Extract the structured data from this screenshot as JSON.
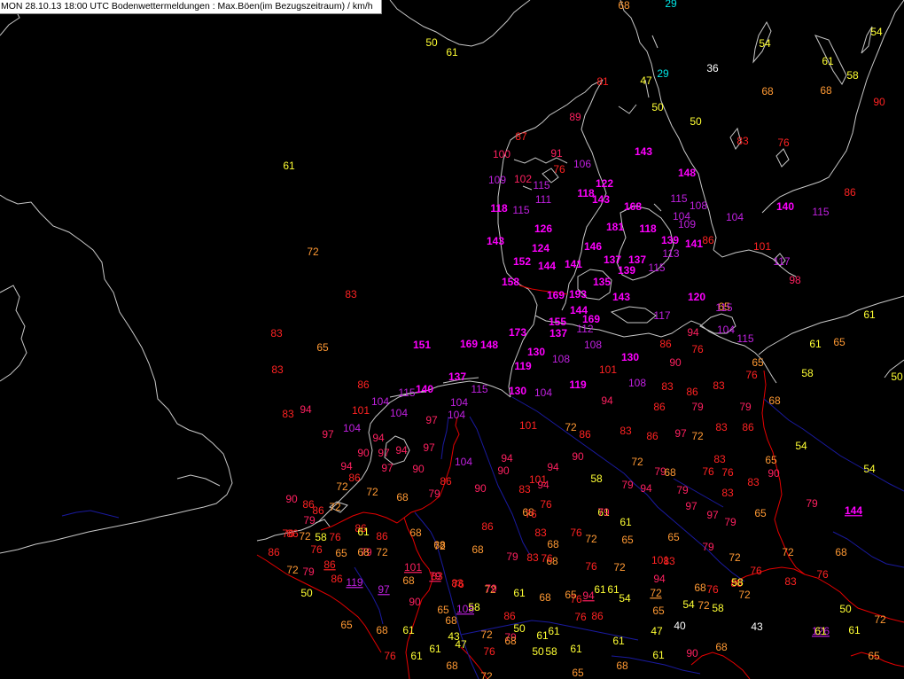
{
  "title": "MON 28.10.13 18:00 UTC  Bodenwettermeldungen :  Max.Böen(im Bezugszeitraum) / km/h",
  "colors": {
    "background": "#000000",
    "coastline": "#c8c8c8",
    "border": "#e60000",
    "river": "#1a1aa0",
    "c_cyan": "#00e5e5",
    "c_white": "#ffffff",
    "c_yellow": "#ffff33",
    "c_orange": "#ff9933",
    "c_red": "#ff2222",
    "c_crimson": "#ff2060",
    "c_violet": "#c020e0",
    "c_magenta": "#ff00ff"
  },
  "observations": [
    {
      "v": "68",
      "c": "orange"
    },
    {
      "v": "29",
      "c": "cyan"
    },
    {
      "v": "50",
      "c": "yellow"
    },
    {
      "v": "61",
      "c": "yellow"
    },
    {
      "v": "54",
      "c": "yellow"
    },
    {
      "v": "54",
      "c": "yellow"
    },
    {
      "v": "61",
      "c": "yellow"
    },
    {
      "v": "58",
      "c": "yellow"
    },
    {
      "v": "36",
      "c": "white"
    },
    {
      "v": "47",
      "c": "yellow"
    },
    {
      "v": "29",
      "c": "cyan"
    },
    {
      "v": "68",
      "c": "orange"
    },
    {
      "v": "68",
      "c": "orange"
    },
    {
      "v": "90",
      "c": "red"
    },
    {
      "v": "81",
      "c": "red"
    },
    {
      "v": "50",
      "c": "yellow"
    },
    {
      "v": "50",
      "c": "yellow"
    },
    {
      "v": "89",
      "c": "crimson"
    },
    {
      "v": "87",
      "c": "red"
    },
    {
      "v": "83",
      "c": "red"
    },
    {
      "v": "76",
      "c": "red"
    },
    {
      "v": "61",
      "c": "yellow"
    },
    {
      "v": "100",
      "c": "crimson"
    },
    {
      "v": "91",
      "c": "crimson"
    },
    {
      "v": "76",
      "c": "red"
    },
    {
      "v": "106",
      "c": "violet"
    },
    {
      "v": "143",
      "c": "magenta"
    },
    {
      "v": "109",
      "c": "violet"
    },
    {
      "v": "102",
      "c": "crimson"
    },
    {
      "v": "115",
      "c": "violet"
    },
    {
      "v": "122",
      "c": "magenta"
    },
    {
      "v": "148",
      "c": "magenta"
    },
    {
      "v": "86",
      "c": "red"
    },
    {
      "v": "111",
      "c": "violet"
    },
    {
      "v": "118",
      "c": "magenta"
    },
    {
      "v": "143",
      "c": "magenta"
    },
    {
      "v": "115",
      "c": "violet"
    },
    {
      "v": "108",
      "c": "violet"
    },
    {
      "v": "118",
      "c": "magenta"
    },
    {
      "v": "115",
      "c": "violet"
    },
    {
      "v": "168",
      "c": "magenta"
    },
    {
      "v": "104",
      "c": "violet"
    },
    {
      "v": "104",
      "c": "violet"
    },
    {
      "v": "140",
      "c": "magenta"
    },
    {
      "v": "115",
      "c": "violet"
    },
    {
      "v": "126",
      "c": "magenta"
    },
    {
      "v": "181",
      "c": "magenta"
    },
    {
      "v": "118",
      "c": "magenta"
    },
    {
      "v": "109",
      "c": "violet"
    },
    {
      "v": "143",
      "c": "magenta"
    },
    {
      "v": "139",
      "c": "magenta"
    },
    {
      "v": "141",
      "c": "magenta"
    },
    {
      "v": "86",
      "c": "red"
    },
    {
      "v": "124",
      "c": "magenta"
    },
    {
      "v": "146",
      "c": "magenta"
    },
    {
      "v": "72",
      "c": "orange"
    },
    {
      "v": "101",
      "c": "red"
    },
    {
      "v": "113",
      "c": "violet"
    },
    {
      "v": "137",
      "c": "magenta"
    },
    {
      "v": "152",
      "c": "magenta"
    },
    {
      "v": "144",
      "c": "magenta"
    },
    {
      "v": "141",
      "c": "magenta"
    },
    {
      "v": "137",
      "c": "magenta"
    },
    {
      "v": "139",
      "c": "magenta"
    },
    {
      "v": "115",
      "c": "violet"
    },
    {
      "v": "117",
      "c": "violet"
    },
    {
      "v": "83",
      "c": "red"
    },
    {
      "v": "158",
      "c": "magenta"
    },
    {
      "v": "135",
      "c": "magenta"
    },
    {
      "v": "98",
      "c": "crimson"
    },
    {
      "v": "169",
      "c": "magenta"
    },
    {
      "v": "193",
      "c": "magenta"
    },
    {
      "v": "143",
      "c": "magenta"
    },
    {
      "v": "120",
      "c": "magenta"
    },
    {
      "v": "65",
      "c": "orange"
    },
    {
      "v": "115",
      "c": "violet"
    },
    {
      "v": "144",
      "c": "magenta"
    },
    {
      "v": "169",
      "c": "magenta"
    },
    {
      "v": "117",
      "c": "violet"
    },
    {
      "v": "61",
      "c": "yellow"
    },
    {
      "v": "83",
      "c": "red"
    },
    {
      "v": "155",
      "c": "magenta"
    },
    {
      "v": "137",
      "c": "magenta"
    },
    {
      "v": "112",
      "c": "violet"
    },
    {
      "v": "94",
      "c": "crimson"
    },
    {
      "v": "104",
      "c": "violet"
    },
    {
      "v": "173",
      "c": "magenta"
    },
    {
      "v": "115",
      "c": "violet"
    },
    {
      "v": "151",
      "c": "magenta"
    },
    {
      "v": "169",
      "c": "magenta"
    },
    {
      "v": "148",
      "c": "magenta"
    },
    {
      "v": "108",
      "c": "violet"
    },
    {
      "v": "86",
      "c": "red"
    },
    {
      "v": "76",
      "c": "red"
    },
    {
      "v": "61",
      "c": "yellow"
    },
    {
      "v": "65",
      "c": "orange"
    },
    {
      "v": "65",
      "c": "orange"
    },
    {
      "v": "130",
      "c": "magenta"
    },
    {
      "v": "108",
      "c": "violet"
    },
    {
      "v": "130",
      "c": "magenta"
    },
    {
      "v": "90",
      "c": "crimson"
    },
    {
      "v": "65",
      "c": "orange"
    },
    {
      "v": "83",
      "c": "red"
    },
    {
      "v": "119",
      "c": "magenta"
    },
    {
      "v": "101",
      "c": "red"
    },
    {
      "v": "76",
      "c": "red"
    },
    {
      "v": "58",
      "c": "yellow"
    },
    {
      "v": "50",
      "c": "yellow"
    },
    {
      "v": "137",
      "c": "magenta"
    },
    {
      "v": "115",
      "c": "violet"
    },
    {
      "v": "119",
      "c": "magenta"
    },
    {
      "v": "108",
      "c": "violet"
    },
    {
      "v": "86",
      "c": "red"
    },
    {
      "v": "115",
      "c": "violet"
    },
    {
      "v": "140",
      "c": "magenta"
    },
    {
      "v": "130",
      "c": "magenta"
    },
    {
      "v": "104",
      "c": "violet"
    },
    {
      "v": "83",
      "c": "red"
    },
    {
      "v": "86",
      "c": "red"
    },
    {
      "v": "83",
      "c": "red"
    },
    {
      "v": "104",
      "c": "violet"
    },
    {
      "v": "104",
      "c": "violet"
    },
    {
      "v": "94",
      "c": "crimson"
    },
    {
      "v": "86",
      "c": "red"
    },
    {
      "v": "79",
      "c": "crimson"
    },
    {
      "v": "79",
      "c": "crimson"
    },
    {
      "v": "68",
      "c": "orange"
    },
    {
      "v": "83",
      "c": "red"
    },
    {
      "v": "94",
      "c": "crimson"
    },
    {
      "v": "101",
      "c": "red"
    },
    {
      "v": "104",
      "c": "violet"
    },
    {
      "v": "104",
      "c": "violet"
    },
    {
      "v": "97",
      "c": "crimson"
    },
    {
      "v": "104",
      "c": "violet"
    },
    {
      "v": "101",
      "c": "red"
    },
    {
      "v": "72",
      "c": "orange"
    },
    {
      "v": "86",
      "c": "red"
    },
    {
      "v": "83",
      "c": "red"
    },
    {
      "v": "86",
      "c": "red"
    },
    {
      "v": "97",
      "c": "crimson"
    },
    {
      "v": "72",
      "c": "orange"
    },
    {
      "v": "83",
      "c": "red"
    },
    {
      "v": "86",
      "c": "red"
    },
    {
      "v": "97",
      "c": "crimson"
    },
    {
      "v": "94",
      "c": "crimson"
    },
    {
      "v": "54",
      "c": "yellow"
    },
    {
      "v": "54",
      "c": "yellow"
    },
    {
      "v": "90",
      "c": "crimson"
    },
    {
      "v": "97",
      "c": "crimson"
    },
    {
      "v": "94",
      "c": "crimson"
    },
    {
      "v": "97",
      "c": "crimson"
    },
    {
      "v": "104",
      "c": "violet"
    },
    {
      "v": "94",
      "c": "crimson"
    },
    {
      "v": "90",
      "c": "crimson"
    },
    {
      "v": "72",
      "c": "orange"
    },
    {
      "v": "83",
      "c": "red"
    },
    {
      "v": "65",
      "c": "orange"
    },
    {
      "v": "94",
      "c": "crimson"
    },
    {
      "v": "97",
      "c": "crimson"
    },
    {
      "v": "90",
      "c": "crimson"
    },
    {
      "v": "94",
      "c": "crimson"
    },
    {
      "v": "90",
      "c": "crimson"
    },
    {
      "v": "79",
      "c": "crimson"
    },
    {
      "v": "68",
      "c": "orange"
    },
    {
      "v": "76",
      "c": "red"
    },
    {
      "v": "76",
      "c": "red"
    },
    {
      "v": "90",
      "c": "crimson"
    },
    {
      "v": "86",
      "c": "red"
    },
    {
      "v": "101",
      "c": "red"
    },
    {
      "v": "72",
      "c": "orange"
    },
    {
      "v": "72",
      "c": "orange"
    },
    {
      "v": "83",
      "c": "red"
    },
    {
      "v": "86",
      "c": "red"
    },
    {
      "v": "58",
      "c": "yellow"
    },
    {
      "v": "79",
      "c": "crimson"
    },
    {
      "v": "94",
      "c": "crimson"
    },
    {
      "v": "79",
      "c": "crimson"
    },
    {
      "v": "90",
      "c": "crimson"
    },
    {
      "v": "86",
      "c": "red"
    },
    {
      "v": "79",
      "c": "crimson"
    },
    {
      "v": "68",
      "c": "orange"
    },
    {
      "v": "90",
      "c": "crimson"
    },
    {
      "v": "83",
      "c": "red"
    },
    {
      "v": "94",
      "c": "crimson"
    },
    {
      "v": "83",
      "c": "red"
    },
    {
      "v": "79",
      "c": "crimson"
    },
    {
      "v": "144",
      "c": "magenta",
      "u": true
    },
    {
      "v": "86",
      "c": "red"
    },
    {
      "v": "72",
      "c": "orange"
    },
    {
      "v": "76",
      "c": "red"
    },
    {
      "v": "68",
      "c": "orange"
    },
    {
      "v": "61",
      "c": "yellow"
    },
    {
      "v": "61",
      "c": "yellow"
    },
    {
      "v": "97",
      "c": "crimson"
    },
    {
      "v": "97",
      "c": "crimson"
    },
    {
      "v": "76",
      "c": "red"
    },
    {
      "v": "79",
      "c": "crimson"
    },
    {
      "v": "65",
      "c": "orange"
    },
    {
      "v": "79",
      "c": "crimson"
    },
    {
      "v": "76",
      "c": "red"
    },
    {
      "v": "86",
      "c": "red"
    },
    {
      "v": "86",
      "c": "red"
    },
    {
      "v": "68",
      "c": "orange"
    },
    {
      "v": "86",
      "c": "red"
    },
    {
      "v": "83",
      "c": "red"
    },
    {
      "v": "76",
      "c": "red"
    },
    {
      "v": "65",
      "c": "orange"
    },
    {
      "v": "65",
      "c": "orange"
    },
    {
      "v": "79",
      "c": "crimson"
    },
    {
      "v": "86",
      "c": "red"
    },
    {
      "v": "72",
      "c": "orange"
    },
    {
      "v": "58",
      "c": "yellow"
    },
    {
      "v": "76",
      "c": "red"
    },
    {
      "v": "61",
      "c": "yellow"
    },
    {
      "v": "72",
      "c": "orange"
    },
    {
      "v": "79",
      "c": "crimson"
    },
    {
      "v": "76",
      "c": "red"
    },
    {
      "v": "65",
      "c": "orange"
    },
    {
      "v": "68",
      "c": "orange"
    },
    {
      "v": "72",
      "c": "orange"
    },
    {
      "v": "79",
      "c": "crimson"
    },
    {
      "v": "86",
      "c": "red"
    },
    {
      "v": "72",
      "c": "orange"
    },
    {
      "v": "68",
      "c": "orange"
    },
    {
      "v": "72",
      "c": "orange"
    },
    {
      "v": "68",
      "c": "orange"
    },
    {
      "v": "101",
      "c": "crimson",
      "u": true
    },
    {
      "v": "68",
      "c": "orange"
    },
    {
      "v": "83",
      "c": "red"
    },
    {
      "v": "68",
      "c": "orange"
    },
    {
      "v": "68",
      "c": "orange"
    },
    {
      "v": "79",
      "c": "crimson"
    },
    {
      "v": "101",
      "c": "red"
    },
    {
      "v": "72",
      "c": "orange"
    },
    {
      "v": "76",
      "c": "red"
    },
    {
      "v": "76",
      "c": "red"
    },
    {
      "v": "72",
      "c": "orange"
    },
    {
      "v": "83",
      "c": "red"
    },
    {
      "v": "76",
      "c": "red"
    },
    {
      "v": "76",
      "c": "red"
    },
    {
      "v": "72",
      "c": "orange"
    },
    {
      "v": "79",
      "c": "crimson"
    },
    {
      "v": "86",
      "c": "red",
      "u": true
    },
    {
      "v": "50",
      "c": "yellow"
    },
    {
      "v": "68",
      "c": "orange"
    },
    {
      "v": "83",
      "c": "red"
    },
    {
      "v": "76",
      "c": "red"
    },
    {
      "v": "72",
      "c": "orange"
    },
    {
      "v": "86",
      "c": "red"
    },
    {
      "v": "83",
      "c": "red"
    },
    {
      "v": "86",
      "c": "red"
    },
    {
      "v": "119",
      "c": "violet",
      "u": true
    },
    {
      "v": "97",
      "c": "violet",
      "u": true
    },
    {
      "v": "79",
      "c": "crimson",
      "u": true
    },
    {
      "v": "83",
      "c": "red"
    },
    {
      "v": "79",
      "c": "crimson"
    },
    {
      "v": "94",
      "c": "crimson"
    },
    {
      "v": "76",
      "c": "red"
    },
    {
      "v": "68",
      "c": "orange"
    },
    {
      "v": "76",
      "c": "red"
    },
    {
      "v": "61",
      "c": "yellow"
    },
    {
      "v": "54",
      "c": "yellow"
    },
    {
      "v": "72",
      "c": "orange",
      "u": true
    },
    {
      "v": "68",
      "c": "orange"
    },
    {
      "v": "72",
      "c": "orange"
    },
    {
      "v": "90",
      "c": "crimson"
    },
    {
      "v": "65",
      "c": "orange"
    },
    {
      "v": "108",
      "c": "violet",
      "u": true
    },
    {
      "v": "61",
      "c": "yellow"
    },
    {
      "v": "65",
      "c": "orange"
    },
    {
      "v": "94",
      "c": "crimson",
      "u": true
    },
    {
      "v": "61",
      "c": "yellow"
    },
    {
      "v": "65",
      "c": "orange"
    },
    {
      "v": "58",
      "c": "yellow"
    },
    {
      "v": "86",
      "c": "red"
    },
    {
      "v": "76",
      "c": "red"
    },
    {
      "v": "86",
      "c": "red"
    },
    {
      "v": "65",
      "c": "orange"
    },
    {
      "v": "72",
      "c": "orange"
    },
    {
      "v": "58",
      "c": "yellow"
    },
    {
      "v": "58",
      "c": "yellow"
    },
    {
      "v": "54",
      "c": "yellow"
    },
    {
      "v": "50",
      "c": "yellow"
    },
    {
      "v": "61",
      "c": "yellow"
    },
    {
      "v": "61",
      "c": "yellow"
    },
    {
      "v": "72",
      "c": "orange"
    },
    {
      "v": "79",
      "c": "crimson"
    },
    {
      "v": "68",
      "c": "orange"
    },
    {
      "v": "61",
      "c": "yellow"
    },
    {
      "v": "47",
      "c": "yellow"
    },
    {
      "v": "40",
      "c": "white"
    },
    {
      "v": "43",
      "c": "yellow"
    },
    {
      "v": "43",
      "c": "white"
    },
    {
      "v": "50",
      "c": "yellow"
    },
    {
      "v": "72",
      "c": "orange"
    },
    {
      "v": "126",
      "c": "violet",
      "u": true
    },
    {
      "v": "68",
      "c": "orange"
    },
    {
      "v": "61",
      "c": "yellow"
    },
    {
      "v": "61",
      "c": "yellow"
    },
    {
      "v": "47",
      "c": "yellow"
    },
    {
      "v": "76",
      "c": "red"
    },
    {
      "v": "68",
      "c": "orange"
    },
    {
      "v": "58",
      "c": "yellow"
    },
    {
      "v": "61",
      "c": "yellow"
    },
    {
      "v": "68",
      "c": "orange"
    },
    {
      "v": "61",
      "c": "yellow"
    },
    {
      "v": "61",
      "c": "yellow"
    },
    {
      "v": "65",
      "c": "orange"
    },
    {
      "v": "76",
      "c": "red"
    },
    {
      "v": "61",
      "c": "yellow"
    },
    {
      "v": "68",
      "c": "orange"
    },
    {
      "v": "72",
      "c": "orange"
    },
    {
      "v": "50",
      "c": "yellow"
    },
    {
      "v": "65",
      "c": "orange"
    },
    {
      "v": "68",
      "c": "orange"
    },
    {
      "v": "61",
      "c": "yellow"
    },
    {
      "v": "90",
      "c": "crimson"
    }
  ]
}
